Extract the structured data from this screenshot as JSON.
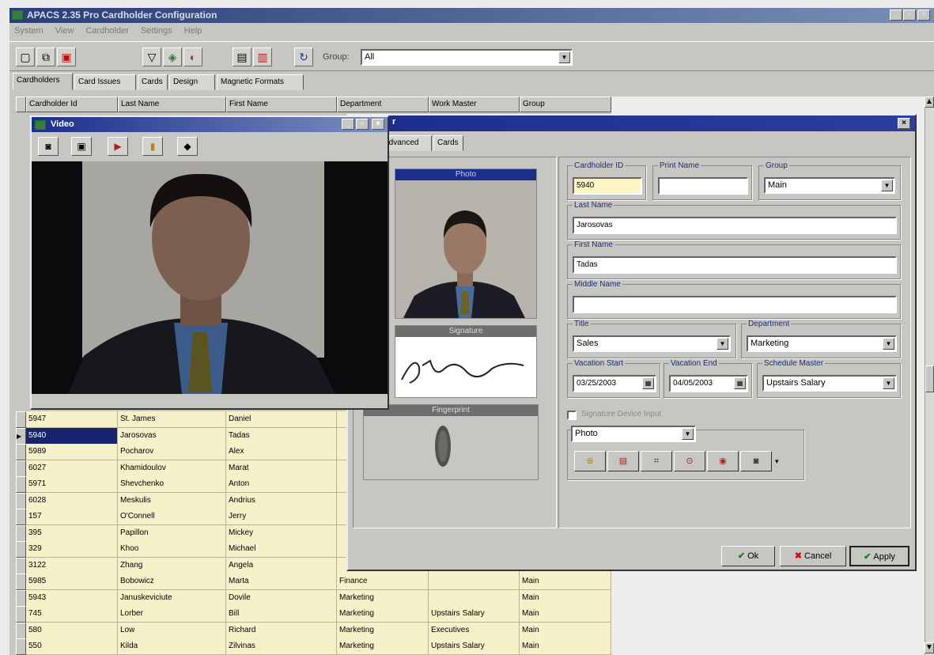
{
  "window": {
    "title": "APACS 2.35 Pro Cardholder Configuration"
  },
  "menu": [
    "System",
    "View",
    "Cardholder",
    "Settings",
    "Help"
  ],
  "toolbar": {
    "group_label": "Group:",
    "group_value": "All"
  },
  "tabs": [
    "Cardholders",
    "Card Issues",
    "Cards",
    "Design",
    "Magnetic Formats"
  ],
  "grid": {
    "columns": [
      "Cardholder Id",
      "Last Name",
      "First Name",
      "Department",
      "Work Master",
      "Group"
    ],
    "rows": [
      {
        "id": "5947",
        "last": "St. James",
        "first": "Daniel",
        "dept": "",
        "work": "",
        "group": ""
      },
      {
        "id": "5940",
        "last": "Jarosovas",
        "first": "Tadas",
        "dept": "",
        "work": "",
        "group": ""
      },
      {
        "id": "5989",
        "last": "Pocharov",
        "first": "Alex",
        "dept": "",
        "work": "",
        "group": ""
      },
      {
        "id": "6027",
        "last": "Khamidoulov",
        "first": "Marat",
        "dept": "",
        "work": "",
        "group": ""
      },
      {
        "id": "5971",
        "last": "Shevchenko",
        "first": "Anton",
        "dept": "",
        "work": "",
        "group": ""
      },
      {
        "id": "6028",
        "last": "Meskulis",
        "first": "Andrius",
        "dept": "",
        "work": "",
        "group": ""
      },
      {
        "id": "157",
        "last": "O'Connell",
        "first": "Jerry",
        "dept": "",
        "work": "",
        "group": ""
      },
      {
        "id": "395",
        "last": "Papillon",
        "first": "Mickey",
        "dept": "",
        "work": "",
        "group": ""
      },
      {
        "id": "329",
        "last": "Khoo",
        "first": "Michael",
        "dept": "",
        "work": "",
        "group": ""
      },
      {
        "id": "3122",
        "last": "Zhang",
        "first": "Angela",
        "dept": "",
        "work": "",
        "group": ""
      },
      {
        "id": "5985",
        "last": "Bobowicz",
        "first": "Marta",
        "dept": "Finance",
        "work": "",
        "group": "Main"
      },
      {
        "id": "5943",
        "last": "Januskeviciute",
        "first": "Dovile",
        "dept": "Marketing",
        "work": "",
        "group": "Main"
      },
      {
        "id": "745",
        "last": "Lorber",
        "first": "Bill",
        "dept": "Marketing",
        "work": "Upstairs Salary",
        "group": "Main"
      },
      {
        "id": "580",
        "last": "Low",
        "first": "Richard",
        "dept": "Marketing",
        "work": "Executives",
        "group": "Main"
      },
      {
        "id": "550",
        "last": "Kilda",
        "first": "Zilvinas",
        "dept": "Marketing",
        "work": "Upstairs Salary",
        "group": "Main"
      }
    ]
  },
  "dialog": {
    "title_suffix": "r",
    "tabs": [
      "Advanced",
      "Cards"
    ],
    "photo_caption": "Photo",
    "signature_caption": "Signature",
    "fingerprint_caption": "Fingerprint",
    "fields": {
      "cardholder_id_label": "Cardholder ID",
      "cardholder_id": "5940",
      "print_name_label": "Print Name",
      "print_name": "",
      "group_label": "Group",
      "group": "Main",
      "last_name_label": "Last Name",
      "last_name": "Jarosovas",
      "first_name_label": "First Name",
      "first_name": "Tadas",
      "middle_name_label": "Middle Name",
      "middle_name": "",
      "title_label": "Title",
      "title": "Sales",
      "department_label": "Department",
      "department": "Marketing",
      "vacation_start_label": "Vacation Start",
      "vacation_start": "03/25/2003",
      "vacation_end_label": "Vacation End",
      "vacation_end": "04/05/2003",
      "schedule_master_label": "Schedule Master",
      "schedule_master": "Upstairs Salary"
    },
    "signature_checkbox_label": "Signature Device Input",
    "media_select": "Photo",
    "ok_label": "Ok",
    "cancel_label": "Cancel",
    "apply_label": "Apply"
  },
  "video": {
    "title": "Video"
  },
  "colors": {
    "title_blue": "#1c2d8c",
    "grid_yellow": "#f7f1c9",
    "selection": "#17246e"
  }
}
